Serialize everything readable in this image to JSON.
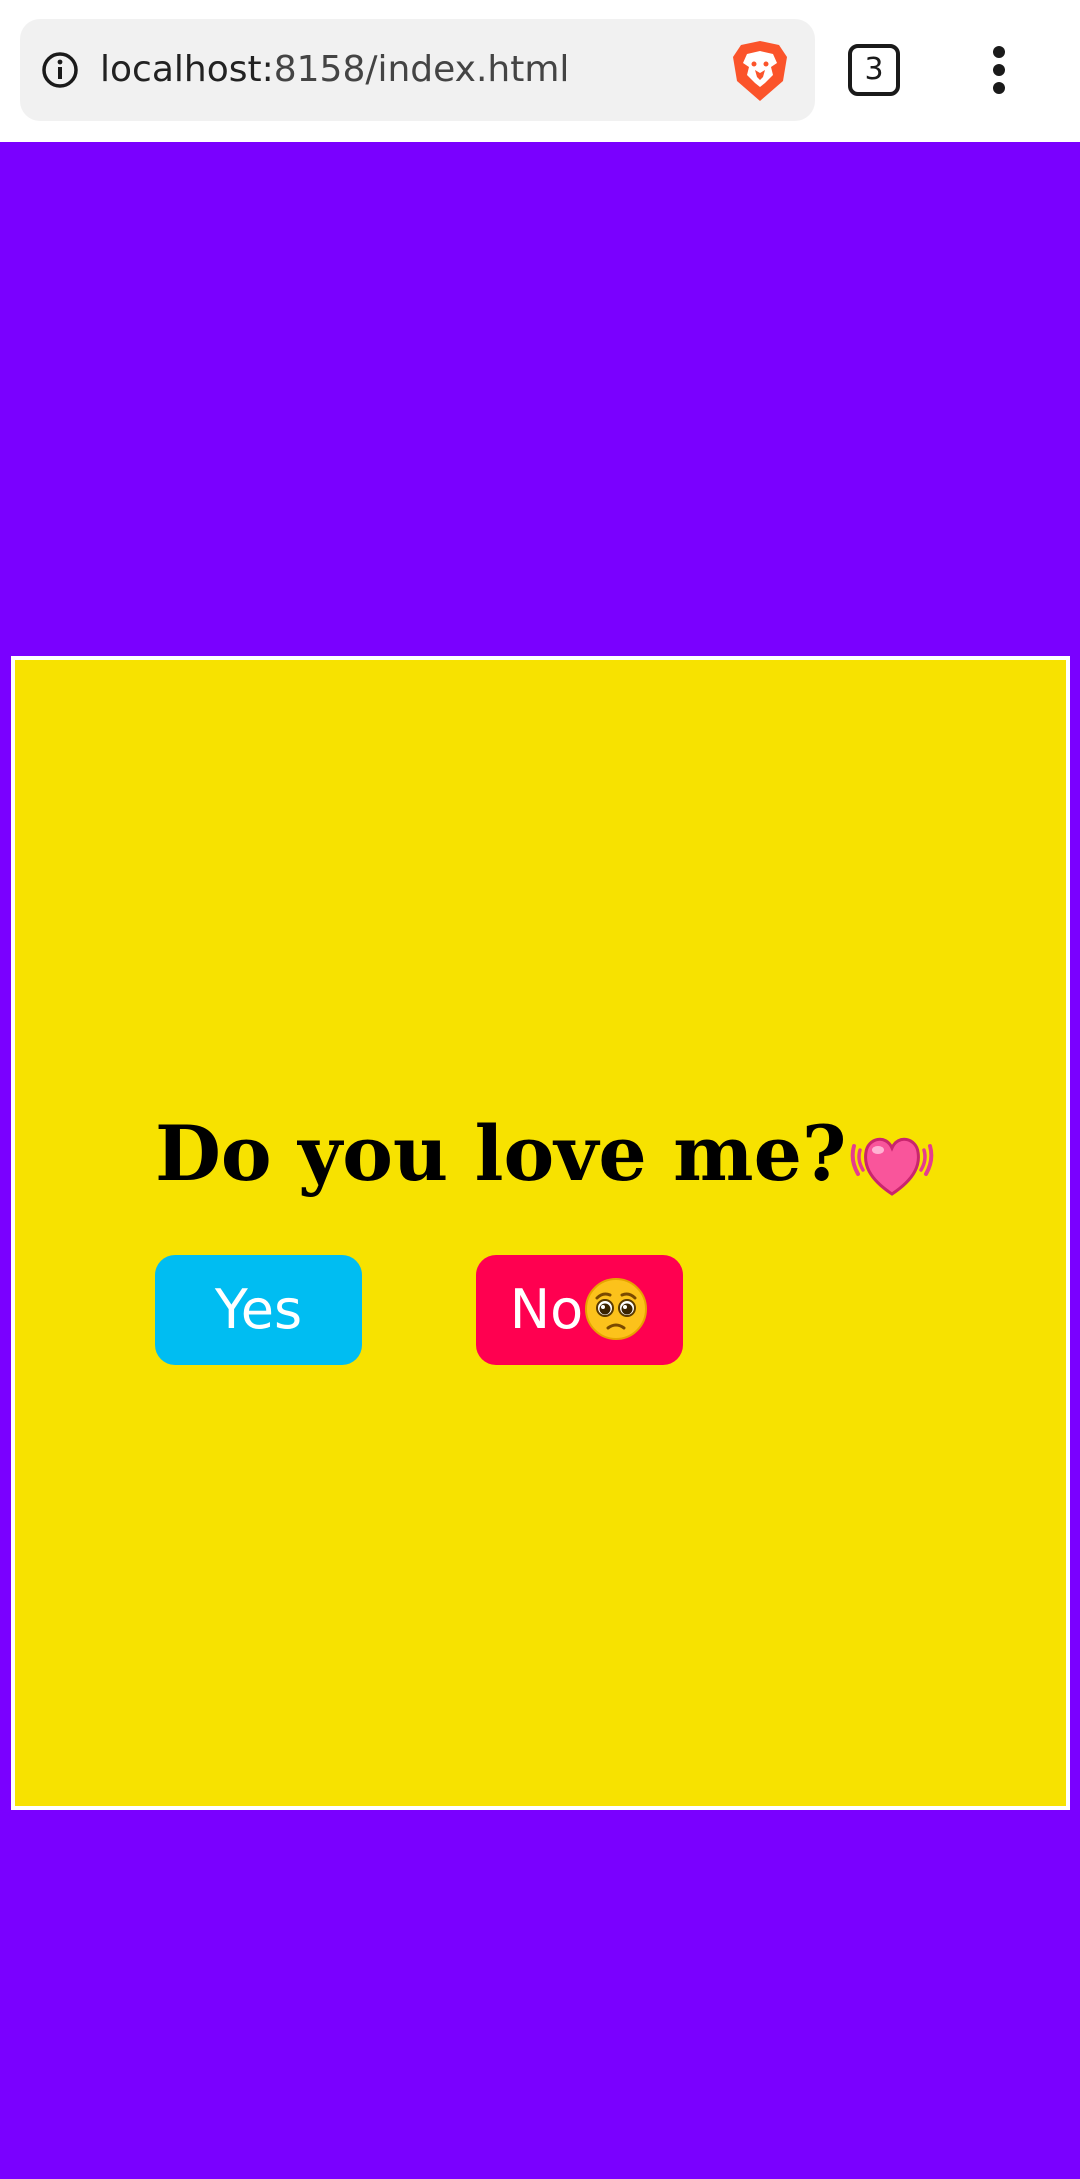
{
  "browser": {
    "url_host": "localhost:",
    "url_path": "8158/index.html",
    "tab_count": "3"
  },
  "page": {
    "question": "Do you love me?",
    "yes_label": "Yes",
    "no_label": "No"
  },
  "icons": {
    "info": "info-icon",
    "brave": "brave-lion-icon",
    "tabs": "tabs-icon",
    "menu": "kebab-menu-icon",
    "heart": "beating-heart-icon",
    "pleading": "pleading-face-icon"
  },
  "colors": {
    "background": "#7a00ff",
    "card": "#f7e200",
    "yes_button": "#00bdf2",
    "no_button": "#ff0050"
  }
}
